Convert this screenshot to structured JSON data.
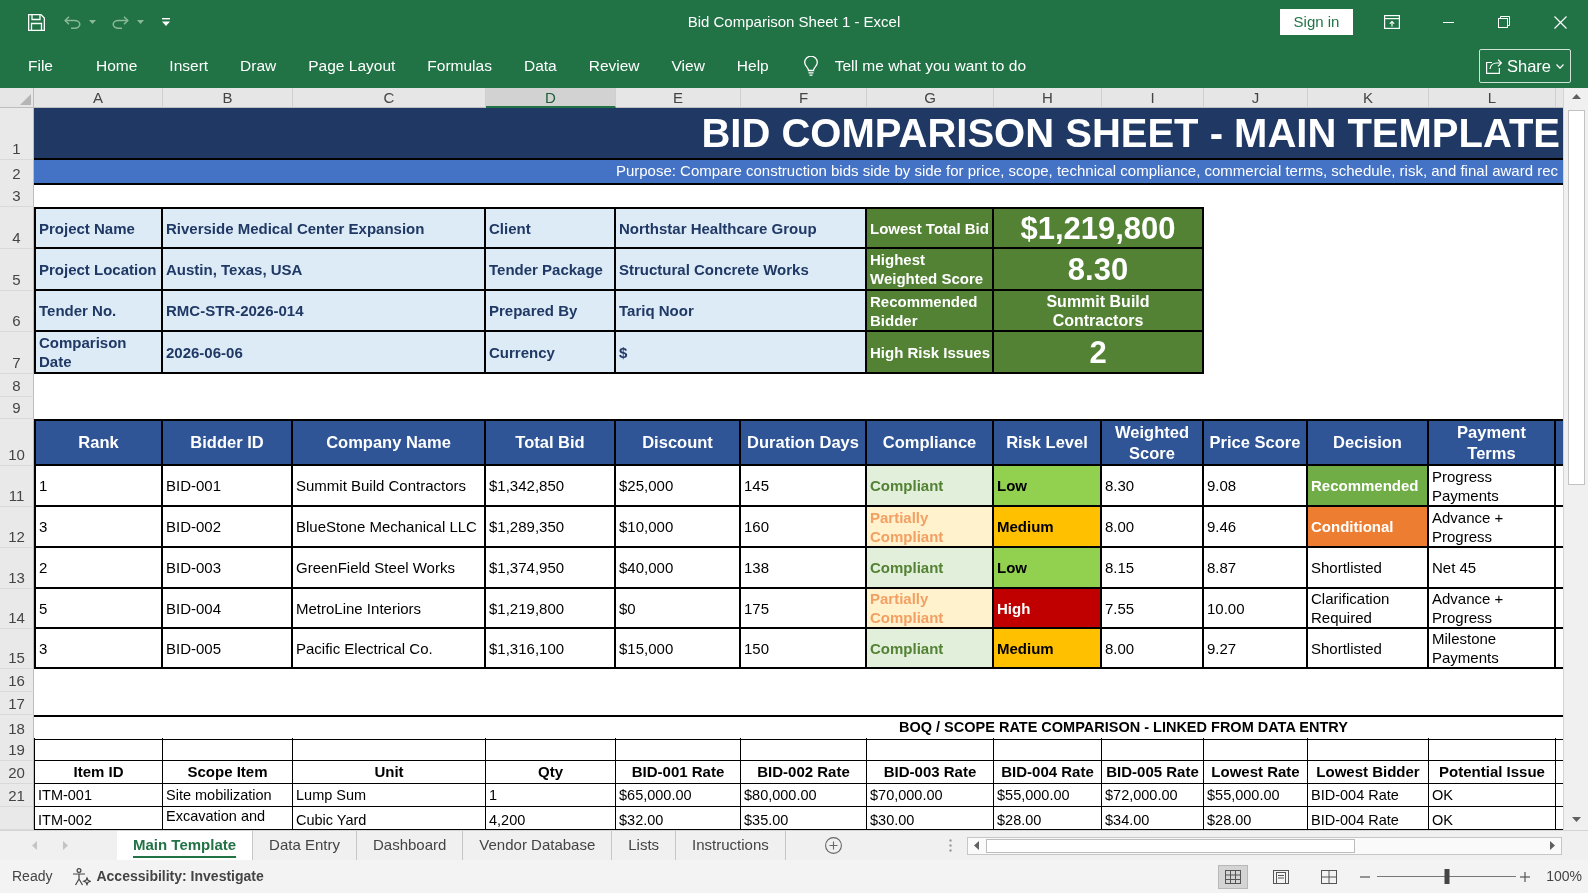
{
  "title_bar": {
    "title": "Bid Comparison Sheet 1 - Excel",
    "sign_in": "Sign in"
  },
  "ribbon": {
    "tabs": [
      "File",
      "Home",
      "Insert",
      "Draw",
      "Page Layout",
      "Formulas",
      "Data",
      "Review",
      "View",
      "Help"
    ],
    "tell_me": "Tell me what you want to do",
    "share": "Share"
  },
  "column_headers": [
    {
      "label": "A",
      "selected": false
    },
    {
      "label": "B",
      "selected": false
    },
    {
      "label": "C",
      "selected": false
    },
    {
      "label": "D",
      "selected": true
    },
    {
      "label": "E",
      "selected": false
    },
    {
      "label": "F",
      "selected": false
    },
    {
      "label": "G",
      "selected": false
    },
    {
      "label": "H",
      "selected": false
    },
    {
      "label": "I",
      "selected": false
    },
    {
      "label": "J",
      "selected": false
    },
    {
      "label": "K",
      "selected": false
    },
    {
      "label": "L",
      "selected": false
    }
  ],
  "row_headers": [
    "1",
    "2",
    "3",
    "4",
    "5",
    "6",
    "7",
    "8",
    "9",
    "10",
    "11",
    "12",
    "13",
    "14",
    "15",
    "16",
    "17",
    "18",
    "19",
    "20",
    "21"
  ],
  "sheet": {
    "title": "BID COMPARISON SHEET - MAIN TEMPLATE",
    "purpose": "Purpose: Compare construction bids side by side for price, scope, technical compliance, commercial terms, schedule, risk, and final award rec",
    "project_info": [
      [
        {
          "label": "Project Name",
          "value": "Riverside Medical Center Expansion"
        },
        {
          "label": "Client",
          "value": "Northstar Healthcare Group"
        }
      ],
      [
        {
          "label": "Project Location",
          "value": "Austin, Texas, USA"
        },
        {
          "label": "Tender Package",
          "value": "Structural Concrete Works"
        }
      ],
      [
        {
          "label": "Tender No.",
          "value": "RMC-STR-2026-014"
        },
        {
          "label": "Prepared By",
          "value": "Tariq Noor"
        }
      ],
      [
        {
          "label": "Comparison Date",
          "value": "2026-06-06"
        },
        {
          "label": "Currency",
          "value": "$"
        }
      ]
    ],
    "summary": [
      {
        "label": "Lowest Total Bid",
        "value": "$1,219,800",
        "kind": "figure"
      },
      {
        "label": "Highest Weighted Score",
        "value": "8.30",
        "kind": "figure"
      },
      {
        "label": "Recommended Bidder",
        "value": "Summit Build Contractors",
        "kind": "text"
      },
      {
        "label": "High Risk Issues",
        "value": "2",
        "kind": "figure"
      }
    ],
    "bids": {
      "columns": [
        "Rank",
        "Bidder ID",
        "Company Name",
        "Total Bid",
        "Discount",
        "Duration Days",
        "Compliance",
        "Risk Level",
        "Weighted Score",
        "Price Score",
        "Decision",
        "Payment Terms"
      ],
      "rows": [
        {
          "rank": "1",
          "bidder_id": "BID-001",
          "company_name": "Summit Build Contractors",
          "total_bid": "$1,342,850",
          "discount": "$25,000",
          "duration_days": "145",
          "compliance": {
            "text": "Compliant",
            "kind": "full"
          },
          "risk_level": {
            "text": "Low",
            "color": "#92d050"
          },
          "weighted_score": "8.30",
          "price_score": "9.08",
          "decision": {
            "text": "Recommended",
            "color": "#70ad47"
          },
          "payment_terms": "Progress Payments"
        },
        {
          "rank": "3",
          "bidder_id": "BID-002",
          "company_name": "BlueStone Mechanical LLC",
          "total_bid": "$1,289,350",
          "discount": "$10,000",
          "duration_days": "160",
          "compliance": {
            "text": "Partially Compliant",
            "kind": "partial"
          },
          "risk_level": {
            "text": "Medium",
            "color": "#ffc000"
          },
          "weighted_score": "8.00",
          "price_score": "9.46",
          "decision": {
            "text": "Conditional",
            "color": "#ed7d31"
          },
          "payment_terms": "Advance + Progress"
        },
        {
          "rank": "2",
          "bidder_id": "BID-003",
          "company_name": "GreenField Steel Works",
          "total_bid": "$1,374,950",
          "discount": "$40,000",
          "duration_days": "138",
          "compliance": {
            "text": "Compliant",
            "kind": "full"
          },
          "risk_level": {
            "text": "Low",
            "color": "#92d050"
          },
          "weighted_score": "8.15",
          "price_score": "8.87",
          "decision": {
            "text": "Shortlisted"
          },
          "payment_terms": "Net 45"
        },
        {
          "rank": "5",
          "bidder_id": "BID-004",
          "company_name": "MetroLine Interiors",
          "total_bid": "$1,219,800",
          "discount": "$0",
          "duration_days": "175",
          "compliance": {
            "text": "Partially Compliant",
            "kind": "partial"
          },
          "risk_level": {
            "text": "High",
            "color": "#c00000"
          },
          "weighted_score": "7.55",
          "price_score": "10.00",
          "decision": {
            "text": "Clarification Required"
          },
          "payment_terms": "Advance + Progress"
        },
        {
          "rank": "3",
          "bidder_id": "BID-005",
          "company_name": "Pacific Electrical Co.",
          "total_bid": "$1,316,100",
          "discount": "$15,000",
          "duration_days": "150",
          "compliance": {
            "text": "Compliant",
            "kind": "full"
          },
          "risk_level": {
            "text": "Medium",
            "color": "#ffc000"
          },
          "weighted_score": "8.00",
          "price_score": "9.27",
          "decision": {
            "text": "Shortlisted"
          },
          "payment_terms": "Milestone Payments"
        }
      ]
    },
    "boq": {
      "title": "BOQ / SCOPE RATE COMPARISON - LINKED FROM DATA ENTRY",
      "columns": [
        "Item ID",
        "Scope Item",
        "Unit",
        "Qty",
        "BID-001 Rate",
        "BID-002 Rate",
        "BID-003 Rate",
        "BID-004 Rate",
        "BID-005 Rate",
        "Lowest Rate",
        "Lowest Bidder",
        "Potential Issue"
      ],
      "rows": [
        [
          "ITM-001",
          "Site mobilization",
          "Lump Sum",
          "1",
          "$65,000.00",
          "$80,000.00",
          "$70,000.00",
          "$55,000.00",
          "$72,000.00",
          "$55,000.00",
          "BID-004 Rate",
          "OK"
        ],
        [
          "ITM-002",
          "Excavation and",
          "Cubic Yard",
          "4,200",
          "$32.00",
          "$35.00",
          "$30.00",
          "$28.00",
          "$34.00",
          "$28.00",
          "BID-004 Rate",
          "OK"
        ]
      ]
    }
  },
  "sheet_tabs": [
    {
      "label": "Main Template",
      "selected": true
    },
    {
      "label": "Data Entry",
      "selected": false
    },
    {
      "label": "Dashboard",
      "selected": false
    },
    {
      "label": "Vendor Database",
      "selected": false
    },
    {
      "label": "Lists",
      "selected": false
    },
    {
      "label": "Instructions",
      "selected": false
    }
  ],
  "status_bar": {
    "mode": "Ready",
    "accessibility": "Accessibility: Investigate",
    "view_buttons": [
      {
        "selected": true
      },
      {
        "selected": false
      },
      {
        "selected": false
      }
    ],
    "zoom": {
      "level": 0.5,
      "label": "100%"
    }
  }
}
